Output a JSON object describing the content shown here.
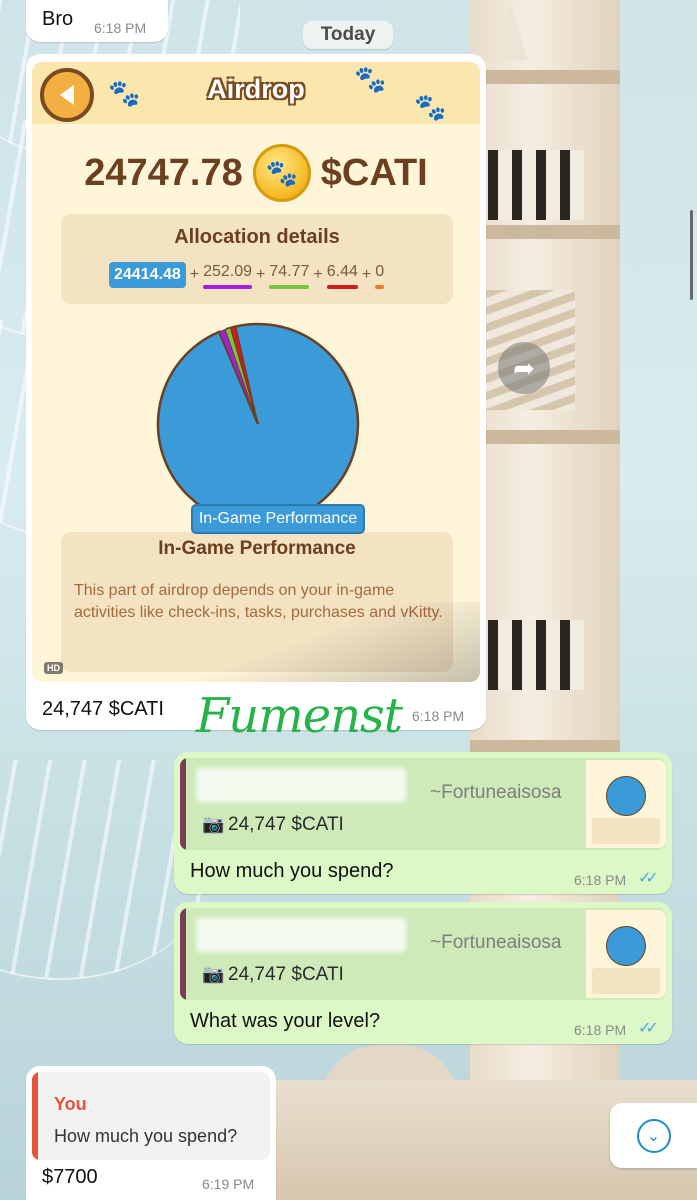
{
  "chat": {
    "top_message": {
      "text": "Bro",
      "time": "6:18 PM"
    },
    "date_chip": "Today",
    "image_message": {
      "caption": "24,747 $CATI",
      "time": "6:18 PM",
      "hd_badge": "HD",
      "image": {
        "title": "Airdrop",
        "amount": "24747.78",
        "currency": "$CATI",
        "allocation_title": "Allocation details",
        "allocation_values": [
          "24414.48",
          "252.09",
          "74.77",
          "6.44",
          "0"
        ],
        "allocation_colors": [
          "#3b9bd8",
          "#a021d9",
          "#7bc443",
          "#c81e1e",
          "#f07a2a"
        ],
        "pie_label": "In-Game Performance",
        "section_title": "In-Game Performance",
        "section_text": "This part of airdrop depends on your in-game activities like check-ins, tasks, purchases and vKitty."
      }
    },
    "handwriting": "Fumenst",
    "reply_1": {
      "quoted_author": "~Fortuneaisosa",
      "quoted_text": "24,747 $CATI",
      "text": "How much you spend?",
      "time": "6:18 PM"
    },
    "reply_2": {
      "quoted_author": "~Fortuneaisosa",
      "quoted_text": "24,747 $CATI",
      "text": "What was your level?",
      "time": "6:18 PM"
    },
    "incoming_reply": {
      "quoted_author": "You",
      "quoted_text": "How much you spend?",
      "text": "$7700",
      "time": "6:19 PM"
    }
  },
  "chart_data": {
    "type": "pie",
    "title": "",
    "labels": [
      "",
      "",
      "",
      "",
      ""
    ],
    "values": [
      24414.48,
      252.09,
      74.77,
      6.44,
      0
    ],
    "colors": [
      "#3b9bd8",
      "#a021d9",
      "#7bc443",
      "#c81e1e",
      "#f07a2a"
    ]
  },
  "icons": {
    "back": "back-arrow-icon",
    "paw": "paw-icon",
    "coin": "paw-coin-icon",
    "forward": "forward-share-icon",
    "camera": "camera-icon",
    "ticks": "read-receipt-icon",
    "scroll_down": "chevron-down-icon"
  },
  "colors": {
    "outgoing_bubble": "#dcf8c6",
    "incoming_bubble": "#ffffff",
    "quote_stripe_group": "#7b3e58",
    "quote_stripe_you": "#e5533b",
    "handwriting": "#27b24a"
  }
}
